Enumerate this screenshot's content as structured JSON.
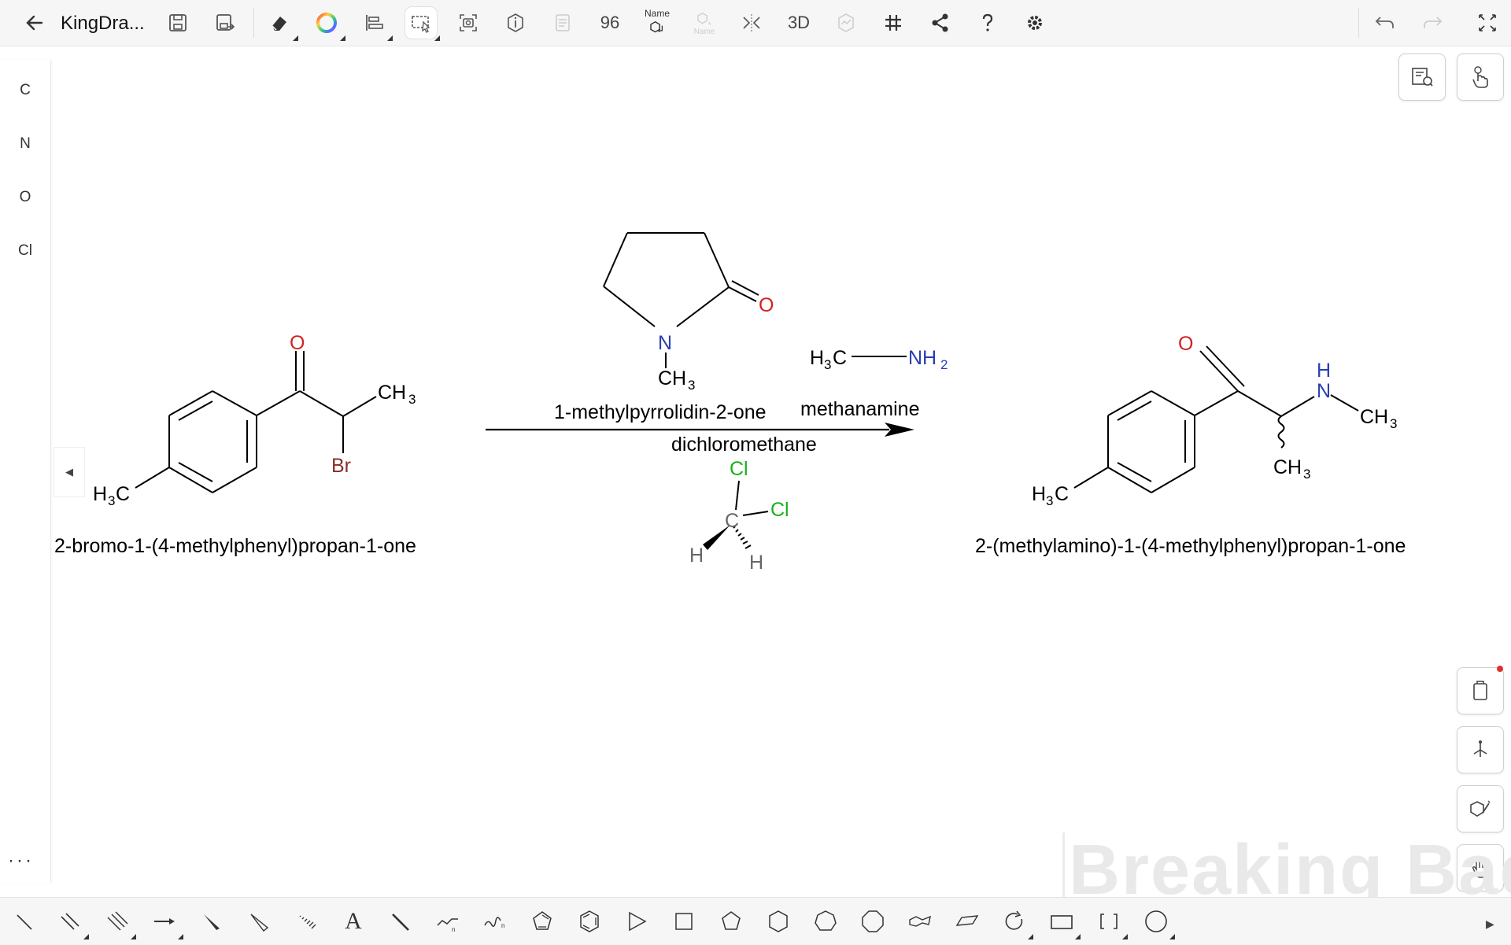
{
  "app": {
    "title": "KingDra..."
  },
  "toolbar": {
    "label_96": "96",
    "name_label": "Name",
    "name_small": "Name",
    "label_3d": "3D"
  },
  "left_panel": {
    "elements": [
      "C",
      "N",
      "O",
      "Cl"
    ],
    "more": "···"
  },
  "reaction": {
    "reactant": {
      "name": "2-bromo-1-(4-methylphenyl)propan-1-one",
      "atoms": {
        "O": "O",
        "Br": "Br",
        "CH": "CH",
        "sub3": "3",
        "H": "H",
        "C": "C"
      }
    },
    "reagent_top": {
      "name": "1-methylpyrrolidin-2-one",
      "atoms": {
        "N": "N",
        "O": "O",
        "CH": "CH",
        "sub3": "3"
      }
    },
    "reagent_amine": {
      "name": "methanamine",
      "atoms": {
        "H": "H",
        "sub3": "3",
        "C": "C",
        "NH": "NH",
        "sub2": "2"
      }
    },
    "solvent": {
      "name": "dichloromethane",
      "atoms": {
        "Cl": "Cl",
        "C": "C",
        "H": "H"
      }
    },
    "product": {
      "name": "2-(methylamino)-1-(4-methylphenyl)propan-1-one",
      "atoms": {
        "O": "O",
        "H": "H",
        "N": "N",
        "CH": "CH",
        "sub3": "3",
        "C": "C"
      }
    }
  },
  "watermark": "Breaking Bad",
  "colors": {
    "oxygen": "#d42020",
    "nitrogen": "#2a3fb0",
    "chlorine": "#19b019",
    "bromine": "#8b2c2c",
    "hydrogen_gray": "#666666"
  }
}
